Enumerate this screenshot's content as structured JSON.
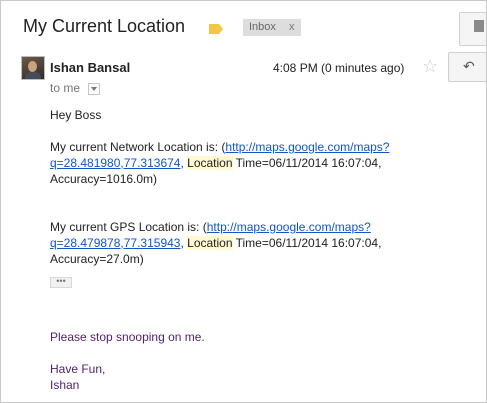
{
  "email": {
    "subject": "My Current Location",
    "label_color": "#f2c646",
    "chip_label": "Inbox",
    "chip_close": "x",
    "sender_name": "Ishan Bansal",
    "time": "4:08 PM (0 minutes ago)",
    "recipient": "to me",
    "greeting": "Hey Boss",
    "network": {
      "prefix": "My current Network Location is: (",
      "link_line1": "http://maps.google.com/maps?",
      "link_line2": "q=28.481980,77.313674",
      "after_link": ", ",
      "location_word": "Location",
      "time_text": " Time=06/11/2014 16:07:04,",
      "accuracy": "Accuracy=1016.0m)"
    },
    "gps": {
      "prefix": "My current GPS Location is: (",
      "link_line1": "http://maps.google.com/maps?",
      "link_line2": "q=28.479878,77.315943",
      "after_link": ", ",
      "location_word": "Location",
      "time_text": " Time=06/11/2014 16:07:04,",
      "accuracy": "Accuracy=27.0m)"
    },
    "expand_dots": "•••",
    "plea": "Please stop snooping on me.",
    "signoff": "Have Fun,",
    "signature": "Ishan"
  },
  "icons": {
    "star": "☆",
    "reply": "↶"
  }
}
